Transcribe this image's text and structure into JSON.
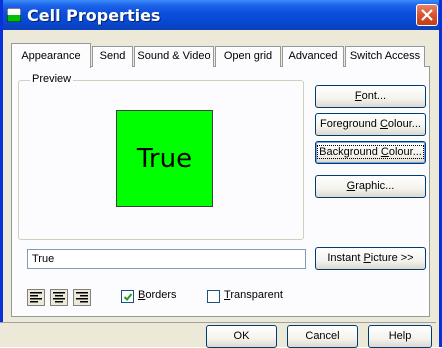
{
  "window": {
    "title": "Cell Properties",
    "titlebar_color": "#0a4fdc",
    "icons": {
      "app": "cell-app-icon",
      "close": "close-icon"
    }
  },
  "tabs": [
    {
      "label": "Appearance",
      "active": true
    },
    {
      "label": "Send",
      "active": false
    },
    {
      "label": "Sound & Video",
      "active": false
    },
    {
      "label": "Open grid",
      "active": false
    },
    {
      "label": "Advanced",
      "active": false
    },
    {
      "label": "Switch Access",
      "active": false
    }
  ],
  "preview": {
    "group_label": "Preview",
    "cell_text": "True",
    "cell_color": "#00ff00"
  },
  "buttons": {
    "font": {
      "pre": "",
      "key": "F",
      "post": "ont..."
    },
    "foreground": {
      "pre": "Foreground ",
      "key": "C",
      "post": "olour..."
    },
    "background": {
      "pre": "Background ",
      "key": "C",
      "post": "olour..."
    },
    "graphic": {
      "pre": "",
      "key": "G",
      "post": "raphic..."
    },
    "instant_picture": {
      "pre": "Instant ",
      "key": "P",
      "post": "icture >>"
    }
  },
  "cell_text_field": {
    "value": "True"
  },
  "alignment": {
    "icons": [
      "align-left-icon",
      "align-center-icon",
      "align-right-icon"
    ]
  },
  "options": {
    "borders": {
      "pre": "",
      "key": "B",
      "post": "orders",
      "checked": true
    },
    "transparent": {
      "pre": "",
      "key": "T",
      "post": "ransparent",
      "checked": false
    }
  },
  "footer": {
    "ok": "OK",
    "cancel": "Cancel",
    "help": "Help"
  }
}
